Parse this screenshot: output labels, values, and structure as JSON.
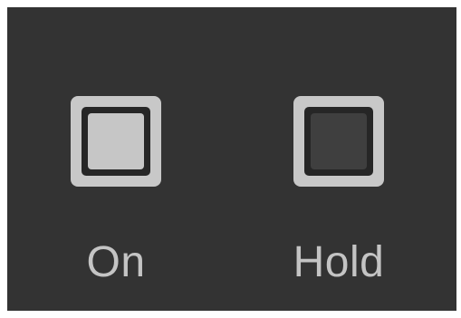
{
  "controls": [
    {
      "label": "On",
      "state": "active",
      "fill_color": "#c6c6c6"
    },
    {
      "label": "Hold",
      "state": "inactive",
      "fill_color": "#3f3f3f"
    }
  ],
  "colors": {
    "panel_background": "#333333",
    "frame": "#c8c8c8",
    "label_text": "#c4c4c4"
  }
}
